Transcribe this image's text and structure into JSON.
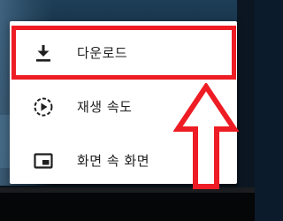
{
  "menu": {
    "items": [
      {
        "label": "다운로드",
        "icon": "download-icon"
      },
      {
        "label": "재생 속도",
        "icon": "playback-speed-icon"
      },
      {
        "label": "화면 속 화면",
        "icon": "picture-in-picture-icon"
      }
    ]
  },
  "annotation": {
    "highlight_color": "#ee1c24",
    "arrow_fill": "#ffffff",
    "arrow_stroke": "#ee1c24"
  }
}
